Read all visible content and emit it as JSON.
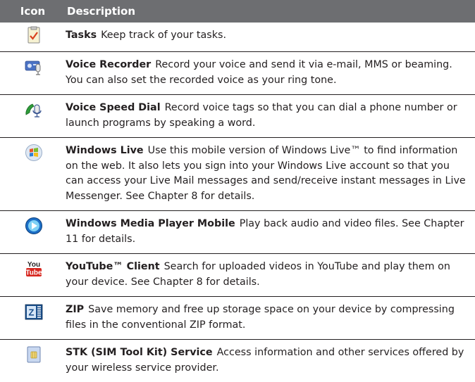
{
  "header": {
    "icon_label": "Icon",
    "description_label": "Description"
  },
  "rows": [
    {
      "name": "Tasks",
      "text": "Keep track of your tasks.",
      "icon": "tasks-icon"
    },
    {
      "name": "Voice Recorder",
      "text": "Record your voice and send it via e-mail, MMS or beaming. You can also set the recorded voice as your ring tone.",
      "icon": "voice-recorder-icon"
    },
    {
      "name": "Voice Speed Dial",
      "text": "Record voice tags so that you can dial a phone number or launch programs by speaking a word.",
      "icon": "voice-speed-dial-icon"
    },
    {
      "name": "Windows Live",
      "text": "Use this mobile version of Windows Live™ to find information on the web. It also lets you sign into your Windows Live account so that you can access your Live Mail messages and send/receive instant messages in Live Messenger. See Chapter 8 for details.",
      "icon": "windows-live-icon"
    },
    {
      "name": "Windows Media Player Mobile",
      "text": "Play back audio and video files. See Chapter 11 for details.",
      "icon": "media-player-icon"
    },
    {
      "name": "YouTube™ Client",
      "text": "Search for uploaded videos in YouTube and play them on your device. See Chapter 8 for details.",
      "icon": "youtube-icon",
      "icon_text_top": "You",
      "icon_text_bottom": "Tube"
    },
    {
      "name": "ZIP",
      "text": "Save memory and free up storage space on your device by compressing files in the conventional ZIP format.",
      "icon": "zip-icon",
      "icon_text": "Z"
    },
    {
      "name": "STK (SIM Tool Kit) Service",
      "text": "Access information and other services offered by your wireless service provider.",
      "icon": "stk-icon"
    }
  ]
}
